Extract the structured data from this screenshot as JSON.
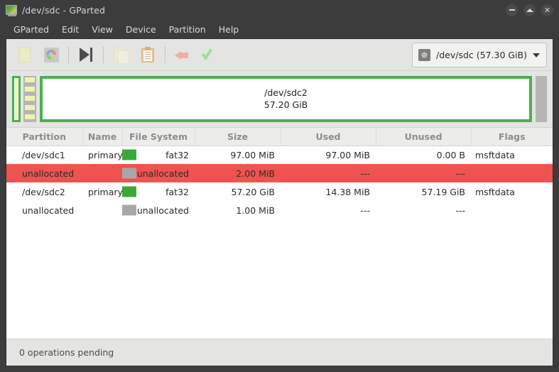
{
  "window": {
    "title": "/dev/sdc - GParted",
    "icon": "gparted-app-icon",
    "controls": {
      "minimize": "Minimize",
      "maximize": "Maximize",
      "close": "Close"
    }
  },
  "menubar": {
    "items": [
      {
        "label": "GParted"
      },
      {
        "label": "Edit"
      },
      {
        "label": "View"
      },
      {
        "label": "Device"
      },
      {
        "label": "Partition"
      },
      {
        "label": "Help"
      }
    ]
  },
  "toolbar": {
    "buttons": [
      {
        "name": "new-partition-button",
        "icon": "new-document-icon",
        "tooltip": "New",
        "enabled": false
      },
      {
        "name": "delete-partition-button",
        "icon": "disk-color-wheel-icon",
        "tooltip": "Delete",
        "enabled": false
      },
      {
        "name": "apply-all-operations-button",
        "icon": "skip-forward-icon",
        "tooltip": "Apply All Operations",
        "enabled": true
      },
      {
        "name": "copy-button",
        "icon": "copy-icon",
        "tooltip": "Copy",
        "enabled": false
      },
      {
        "name": "paste-button",
        "icon": "clipboard-paste-icon",
        "tooltip": "Paste",
        "enabled": true
      },
      {
        "name": "undo-button",
        "icon": "undo-arrow-icon",
        "tooltip": "Undo Last Operation",
        "enabled": false
      },
      {
        "name": "apply-button",
        "icon": "green-check-icon",
        "tooltip": "Apply All Operations",
        "enabled": false
      }
    ]
  },
  "device_selector": {
    "icon": "hard-disk-icon",
    "value": "/dev/sdc (57.30 GiB)",
    "arrow": "chevron-down-icon"
  },
  "graphic": {
    "segments": [
      {
        "name": "sdc1",
        "kind": "partition",
        "color": "#4caf50",
        "fill": "#f2f1b2"
      },
      {
        "name": "unallocated-1",
        "kind": "unallocated",
        "color": "#b5b5b3"
      },
      {
        "name": "sdc2",
        "kind": "partition",
        "color": "#4caf50",
        "title": "/dev/sdc2",
        "size": "57.20 GiB"
      },
      {
        "name": "unallocated-2",
        "kind": "unallocated",
        "color": "#b5b5b3"
      }
    ]
  },
  "table": {
    "headers": [
      "Partition",
      "Name",
      "File System",
      "Size",
      "Used",
      "Unused",
      "Flags"
    ],
    "rows": [
      {
        "partition": "/dev/sdc1",
        "name": "primary",
        "swatch": "#3aa93a",
        "filesystem": "fat32",
        "size": "97.00 MiB",
        "used": "97.00 MiB",
        "unused": "0.00 B",
        "flags": "msftdata",
        "selected": false
      },
      {
        "partition": "unallocated",
        "name": "",
        "swatch": "#a8a8a6",
        "filesystem": "unallocated",
        "size": "2.00 MiB",
        "used": "---",
        "unused": "---",
        "flags": "",
        "selected": true
      },
      {
        "partition": "/dev/sdc2",
        "name": "primary",
        "swatch": "#3aa93a",
        "filesystem": "fat32",
        "size": "57.20 GiB",
        "used": "14.38 MiB",
        "unused": "57.19 GiB",
        "flags": "msftdata",
        "selected": false
      },
      {
        "partition": "unallocated",
        "name": "",
        "swatch": "#a8a8a6",
        "filesystem": "unallocated",
        "size": "1.00 MiB",
        "used": "---",
        "unused": "---",
        "flags": "",
        "selected": false
      }
    ]
  },
  "statusbar": {
    "text": "0 operations pending"
  },
  "colors": {
    "titlebar": "#3c3c3c",
    "selection": "#ef5350",
    "partition_green": "#4caf50",
    "unallocated_gray": "#b5b5b3",
    "fat32_yellow": "#f2f1b2"
  }
}
